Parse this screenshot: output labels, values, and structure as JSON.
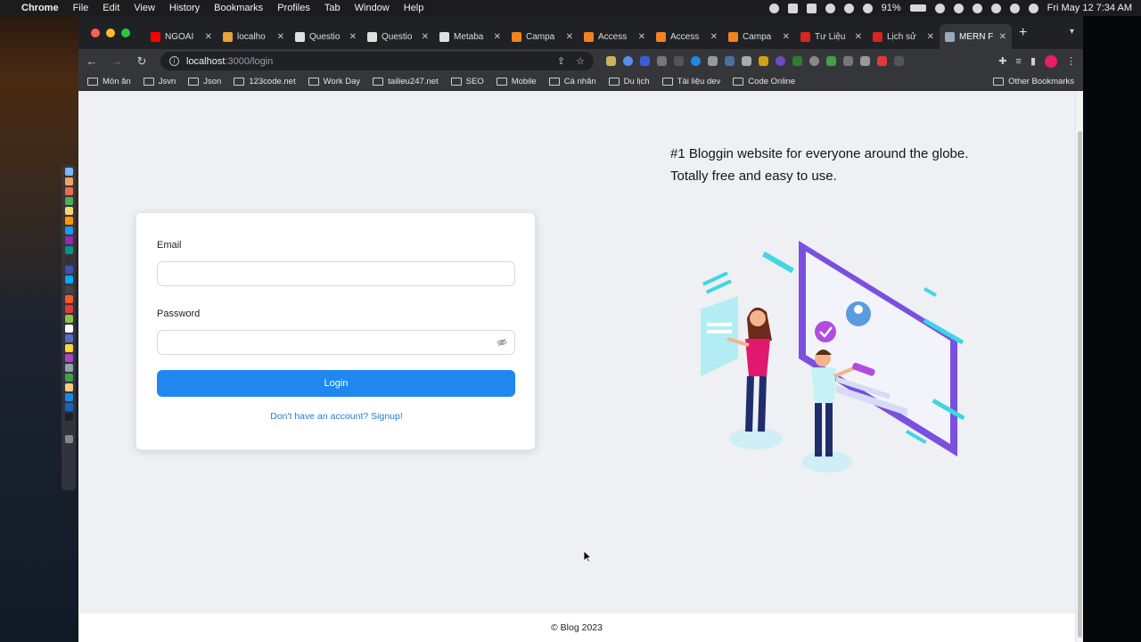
{
  "menubar": {
    "app": "Chrome",
    "items": [
      "File",
      "Edit",
      "View",
      "History",
      "Bookmarks",
      "Profiles",
      "Tab",
      "Window",
      "Help"
    ],
    "battery": "91%",
    "clock": "Fri May 12  7:34 AM"
  },
  "tabs": [
    {
      "label": "NGOÀI",
      "color": "#ff0000"
    },
    {
      "label": "localho",
      "color": "#e8a33c"
    },
    {
      "label": "Questio",
      "color": "#e0e0e0"
    },
    {
      "label": "Questio",
      "color": "#e0e0e0"
    },
    {
      "label": "Metaba",
      "color": "#e0e0e0"
    },
    {
      "label": "Campa",
      "color": "#f58220"
    },
    {
      "label": "Access",
      "color": "#f58220"
    },
    {
      "label": "Access",
      "color": "#f58220"
    },
    {
      "label": "Campa",
      "color": "#f58220"
    },
    {
      "label": "Tư Liệu",
      "color": "#da251d"
    },
    {
      "label": "Lịch sử",
      "color": "#da251d"
    },
    {
      "label": "MERN F",
      "color": "#9ab"
    }
  ],
  "address": {
    "host": "localhost",
    "path": ":3000/login"
  },
  "bookmarks": [
    "Món ăn",
    "Jsvn",
    "Json",
    "123code.net",
    "Work Day",
    "tailieu247.net",
    "SEO",
    "Mobile",
    "Cá nhân",
    "Du lịch",
    "Tài liệu dev",
    "Code Online"
  ],
  "other_bookmarks": "Other Bookmarks",
  "form": {
    "email_label": "Email",
    "email_value": "",
    "password_label": "Password",
    "password_value": "",
    "login_label": "Login",
    "signup_link": "Don't have an account? Signup!"
  },
  "tagline": {
    "line1": "#1 Bloggin website for everyone around the globe.",
    "line2": "Totally free and easy to use."
  },
  "footer": "© Blog 2023",
  "colors": {
    "primary": "#1e88f0",
    "link": "#1f7ed6",
    "page_bg": "#eef0f3"
  }
}
